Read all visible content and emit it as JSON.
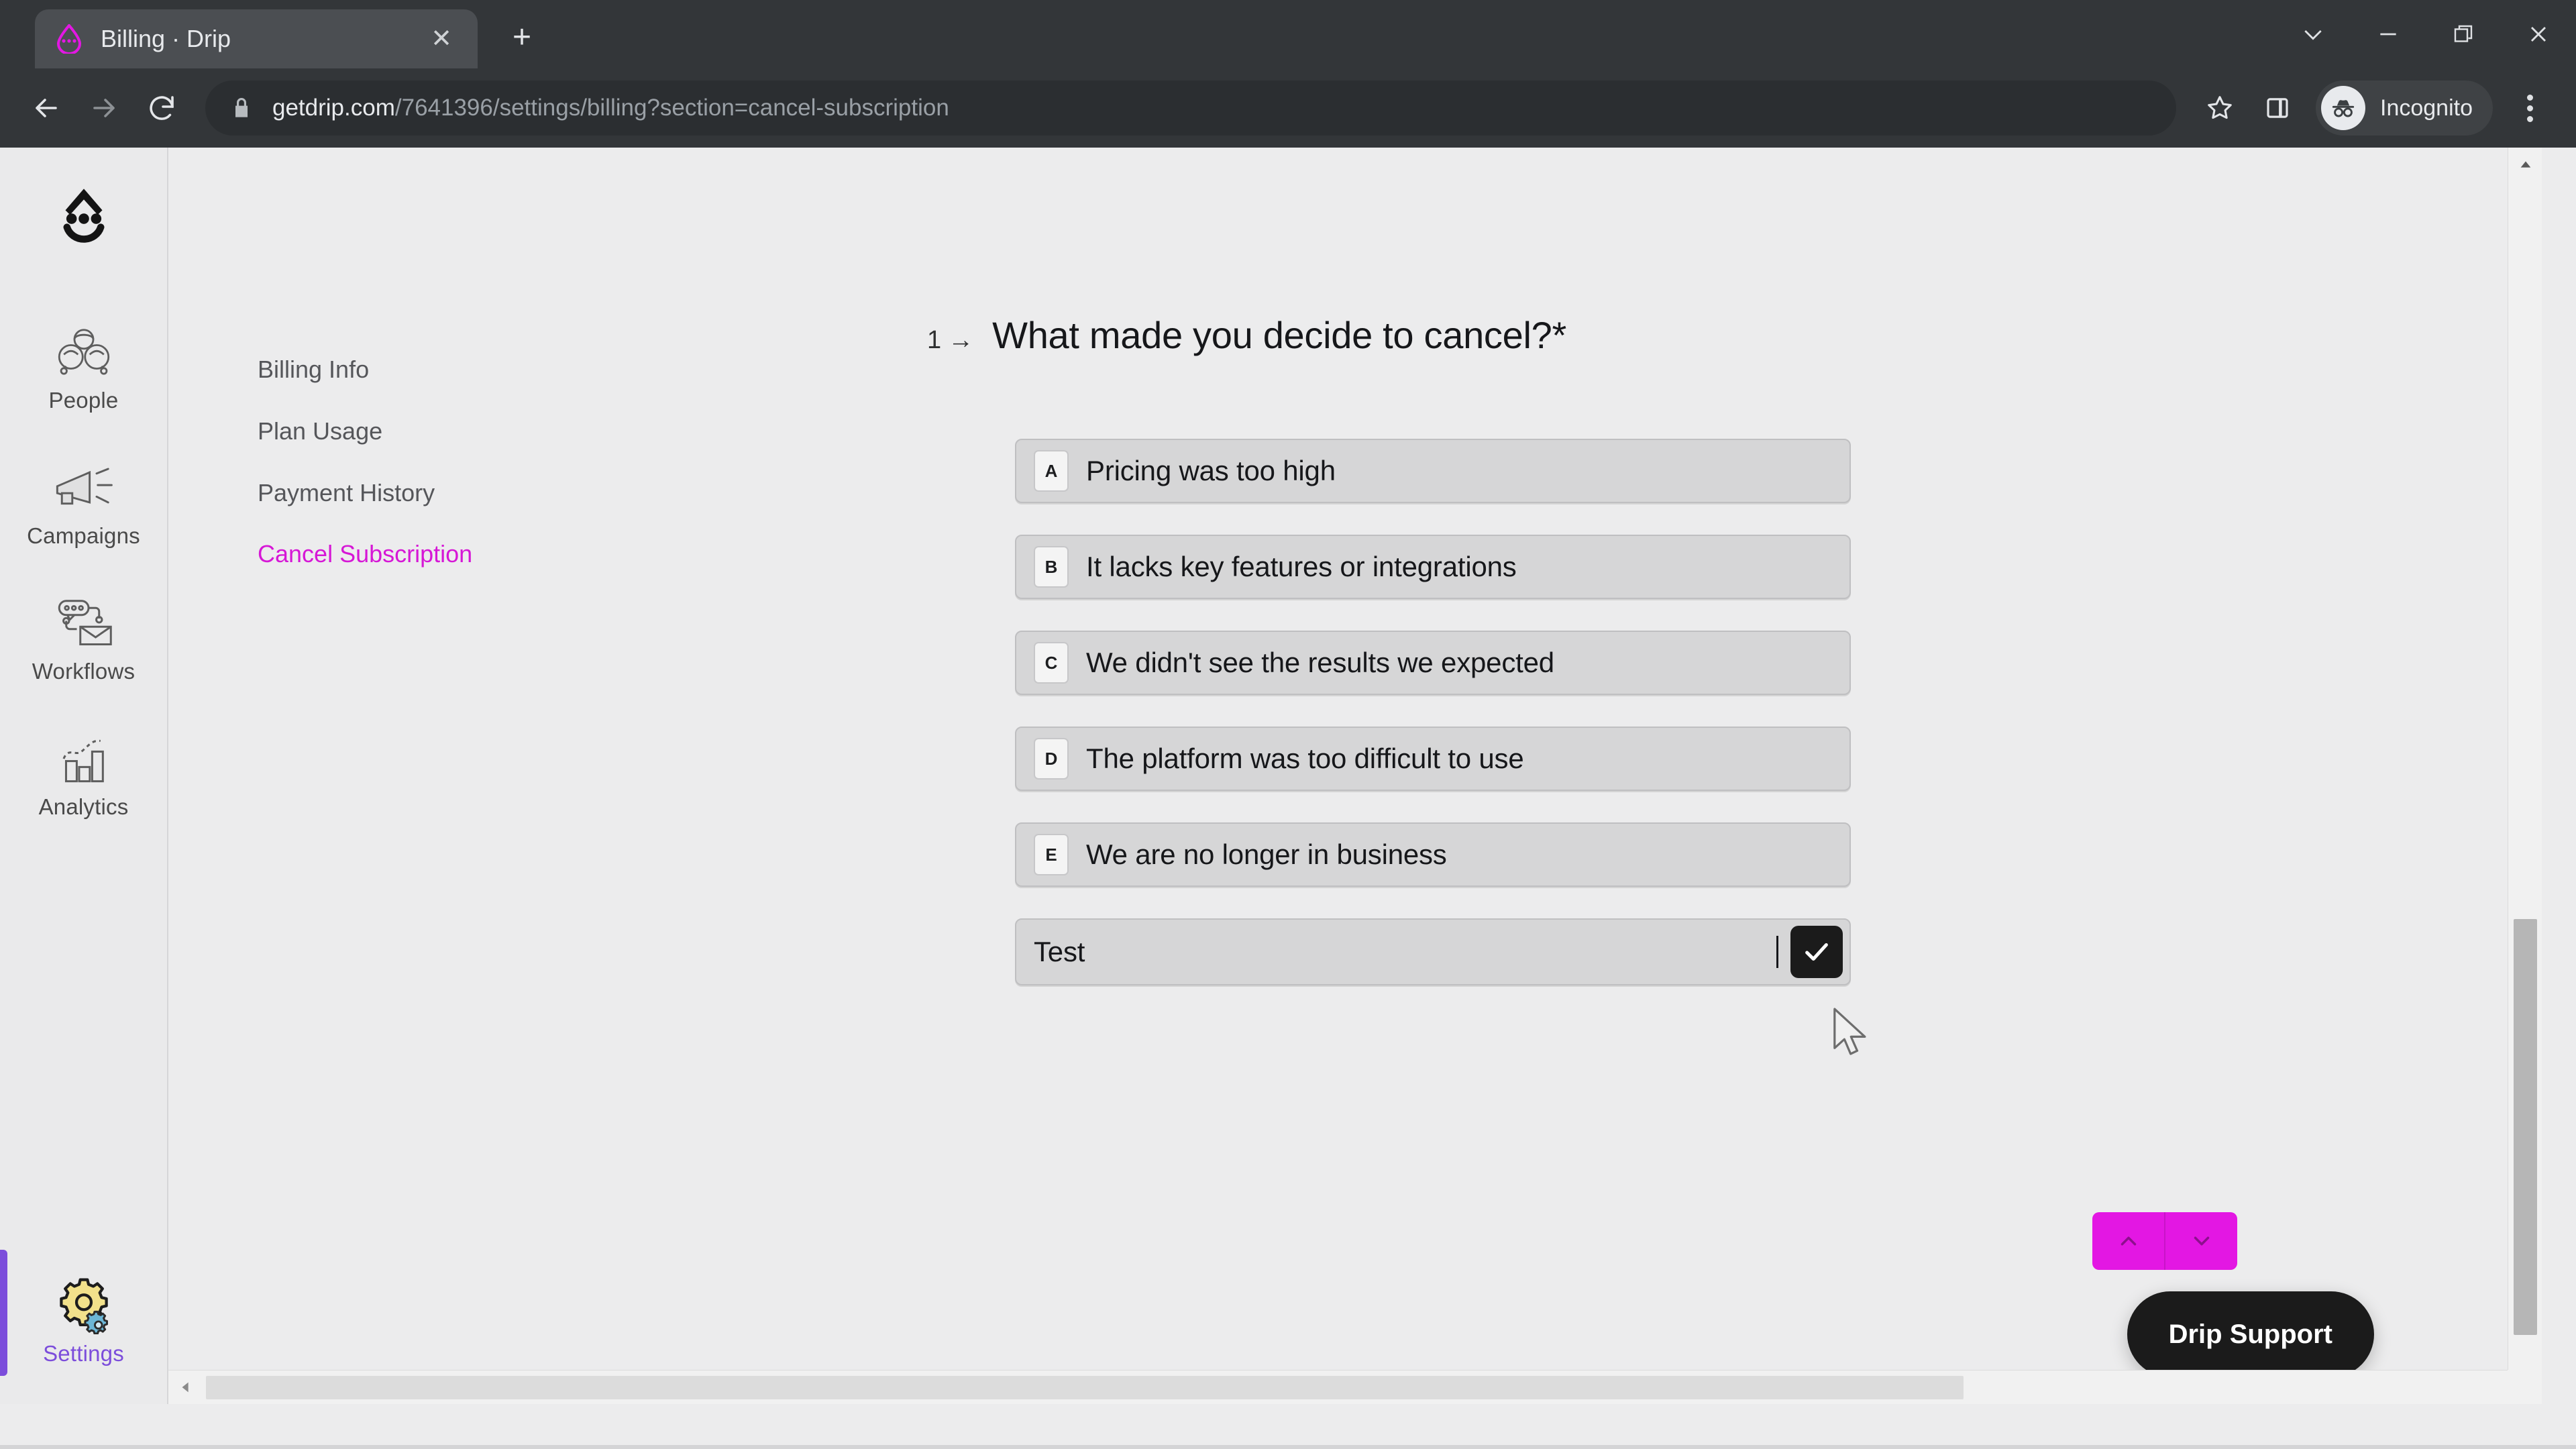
{
  "browser": {
    "tab": {
      "title": "Billing · Drip",
      "favicon_icon": "drip-droplet-icon",
      "close_icon": "close-icon"
    },
    "new_tab_icon": "plus-icon",
    "window_controls": [
      {
        "name": "tab-search-button",
        "icon": "chevron-down-icon",
        "glyph": "∨"
      },
      {
        "name": "minimize-button",
        "icon": "minimize-icon",
        "glyph": "—"
      },
      {
        "name": "maximize-button",
        "icon": "restore-icon",
        "glyph": "❐"
      },
      {
        "name": "close-window-button",
        "icon": "close-icon",
        "glyph": "✕"
      }
    ],
    "toolbar": {
      "back_icon": "arrow-left-icon",
      "forward_icon": "arrow-right-icon",
      "reload_icon": "reload-icon",
      "lock_icon": "lock-icon",
      "url_domain": "getdrip.com",
      "url_path": "/7641396/settings/billing?section=cancel-subscription",
      "url_full": "getdrip.com/7641396/settings/billing?section=cancel-subscription",
      "bookmark_icon": "star-icon",
      "sidepanel_icon": "side-panel-icon",
      "incognito_label": "Incognito",
      "incognito_icon": "incognito-hat-glasses-icon",
      "menu_icon": "kebab-menu-icon"
    }
  },
  "app": {
    "rail": {
      "logo_icon": "drip-logo-icon",
      "items": [
        {
          "label": "People",
          "icon": "people-icon",
          "active": false
        },
        {
          "label": "Campaigns",
          "icon": "megaphone-icon",
          "active": false
        },
        {
          "label": "Workflows",
          "icon": "workflow-icon",
          "active": false
        },
        {
          "label": "Analytics",
          "icon": "bar-chart-icon",
          "active": false
        }
      ],
      "bottom_item": {
        "label": "Settings",
        "icon": "gear-icon",
        "active": true
      }
    },
    "settings_nav": [
      {
        "label": "Billing Info",
        "active": false
      },
      {
        "label": "Plan Usage",
        "active": false
      },
      {
        "label": "Payment History",
        "active": false
      },
      {
        "label": "Cancel Subscription",
        "active": true
      }
    ],
    "survey": {
      "step_number": "1",
      "step_arrow": "→",
      "question": "What made you decide to cancel?*",
      "options": [
        {
          "key": "A",
          "label": "Pricing was too high"
        },
        {
          "key": "B",
          "label": "It lacks key features or integrations"
        },
        {
          "key": "C",
          "label": "We didn't see the results we expected"
        },
        {
          "key": "D",
          "label": "The platform was too difficult to use"
        },
        {
          "key": "E",
          "label": "We are no longer in business"
        }
      ],
      "other_input": {
        "value": "Test",
        "placeholder": ""
      },
      "submit_icon": "check-icon"
    },
    "support": {
      "button_label": "Drip Support",
      "prev_icon": "chevron-up-icon",
      "next_icon": "chevron-down-icon"
    }
  },
  "colors": {
    "brand_magenta": "#d617d6",
    "accent_purple": "#7c4ddb",
    "page_bg": "#ececed",
    "option_bg": "#d6d6d7",
    "submit_dark": "#1b1b1b",
    "chrome_dark": "#333639"
  }
}
